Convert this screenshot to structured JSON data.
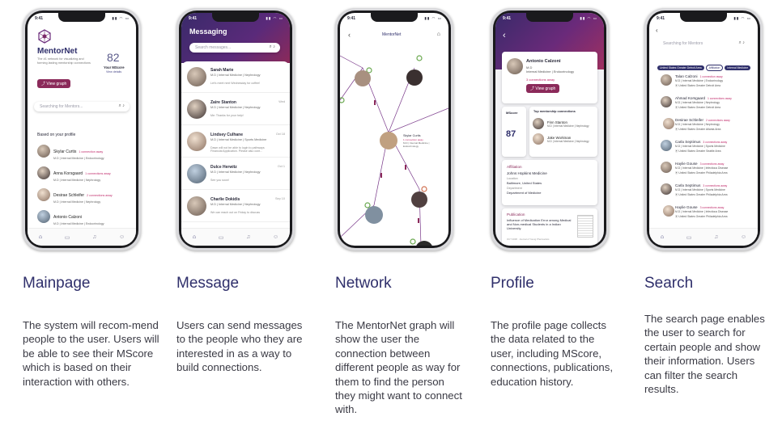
{
  "status_time": "9:41",
  "colors": {
    "brand": "#2f2f6b",
    "accent": "#8b2a5a",
    "connection": "#c02a6a"
  },
  "nav_icons": [
    "home-icon",
    "chat-icon",
    "bell-icon",
    "user-icon"
  ],
  "mainpage": {
    "app_name": "MentorNet",
    "tagline": "The #1 network for visualizing and forming lasting mentorship connections",
    "mscore_value": "82",
    "mscore_label": "Your MScore",
    "view_details": "View details",
    "view_graph": "View graph",
    "search_placeholder": "Searching for Mentors...",
    "section_title": "Based on your profile",
    "people": [
      {
        "name": "Skylar Curtis",
        "conn": "1 connection away",
        "meta": "M.D | Internal Medicine | Endocrinology"
      },
      {
        "name": "Anna Korsgaard",
        "conn": "1 connections away",
        "meta": "M.D | Internal Medicine | Nephrology"
      },
      {
        "name": "Desirae Schleifer",
        "conn": "2 connections away",
        "meta": "M.D | Internal Medicine | Nephrology"
      },
      {
        "name": "Antonio Calzoni",
        "conn": "",
        "meta": "M.D | Internal Medicine | Endocrinology"
      }
    ]
  },
  "message": {
    "title": "Messaging",
    "search_placeholder": "Search messages...",
    "threads": [
      {
        "name": "Sarah Marie",
        "meta": "M.D | Internal Medicine | Nephrology",
        "preview": "Let's meet next Wednesday for coffee!",
        "time": ""
      },
      {
        "name": "Zaire Stanton",
        "meta": "M.D | Internal Medicine | Nephrology",
        "preview": "Me: Thanks for your help!",
        "time": "Wed"
      },
      {
        "name": "Lindsey Culhane",
        "meta": "M.D | Internal Medicine | Sports Medicine",
        "preview": "Dawn will not be able to login to pathways Financial Application. Please also cont...",
        "time": "Oct 18"
      },
      {
        "name": "Dulce Herwitz",
        "meta": "M.D | Internal Medicine | Nephrology",
        "preview": "See you soon!",
        "time": "Oct 1"
      },
      {
        "name": "Charlie Dokidis",
        "meta": "M.D | Internal Medicine | Nephrology",
        "preview": "We can reach out on Friday to discuss",
        "time": "Sep 10"
      }
    ]
  },
  "network": {
    "title": "MentorNet",
    "focus_name": "Skylar Curtis",
    "focus_conn": "1 connection away",
    "focus_meta": "M.D | Internal Medicine | Endocrinology"
  },
  "profile": {
    "name": "Antonio Calzoni",
    "degree": "M.D",
    "specialty": "Internal Medicine | Endocrinology",
    "conn": "3 connections away",
    "view_graph": "View graph",
    "mscore_label": "MScore",
    "mscore_value": "87",
    "top_label": "Top mentorship connections",
    "connections": [
      {
        "name": "Finn Stanton",
        "meta": "M.D | Internal Medicine | Nephrology"
      },
      {
        "name": "Jake Workman",
        "meta": "M.D | Internal Medicine | Nephrology"
      }
    ],
    "affiliation_label": "Affiliation",
    "affiliation_name": "Johns Hopkins Medicine",
    "location_label": "Location",
    "location_value": "Baltimore, United States",
    "department_label": "Department",
    "department_value": "Department of Medicine",
    "publication_label": "Publication",
    "publication_title": "Influence of Medication Error among Medical and Non-medical Students in a Indian University",
    "publication_meta": "OCT 2008 · Journal of Young Pharmacists"
  },
  "search": {
    "placeholder": "Searching for Mentors",
    "filters": [
      "United States Greater Detroit Area",
      "Affiliation",
      "Internal Medicine"
    ],
    "results": [
      {
        "name": "Talan Calzoni",
        "conn": "1 connection away",
        "meta": "M.D | Internal Medicine | Endocrinology",
        "loc": "United States Greater Detroit Area"
      },
      {
        "name": "Ahmad Korsgaard",
        "conn": "1 connections away",
        "meta": "M.D | Internal Medicine | Nephrology",
        "loc": "United States Greater Detroit Area"
      },
      {
        "name": "Desirae Schleifer",
        "conn": "2 connections away",
        "meta": "M.D | Internal Medicine | Nephrology",
        "loc": "United States Greater Atlanta Area"
      },
      {
        "name": "Carla Septimus",
        "conn": "3 connections away",
        "meta": "M.D | Internal Medicine | Sports Medicine",
        "loc": "United States Greater Seattle Area"
      },
      {
        "name": "Haylie Gouse",
        "conn": "3 connections away",
        "meta": "M.D | Internal Medicine | Infectious Disease",
        "loc": "United States Greater Philadelphia Area"
      },
      {
        "name": "Carla Septimus",
        "conn": "3 connections away",
        "meta": "M.D | Internal Medicine | Sports Medicine",
        "loc": "United States Greater Philadelphia Area"
      },
      {
        "name": "Haylie Gouse",
        "conn": "3 connections away",
        "meta": "M.D | Internal Medicine | Infectious Disease",
        "loc": "United States Greater Philadelphia Area"
      }
    ]
  },
  "captions": {
    "mainpage": {
      "title": "Mainpage",
      "text": "The system will recom-mend people to the user. Users will be able to see their MScore which is based on their interaction with others."
    },
    "message": {
      "title": "Message",
      "text": "Users can send messages to the people who they are interested in as a way to build connections."
    },
    "network": {
      "title": "Network",
      "text": "The MentorNet graph will show the user the connection between different people as way for them to find the person they might want to connect with."
    },
    "profile": {
      "title": "Profile",
      "text": "The profile page collects the data related to the user, including MScore, connections, publications, education history."
    },
    "search": {
      "title": "Search",
      "text": "The search page enables the user to search for certain people and show their information. Users can filter the search results."
    }
  }
}
